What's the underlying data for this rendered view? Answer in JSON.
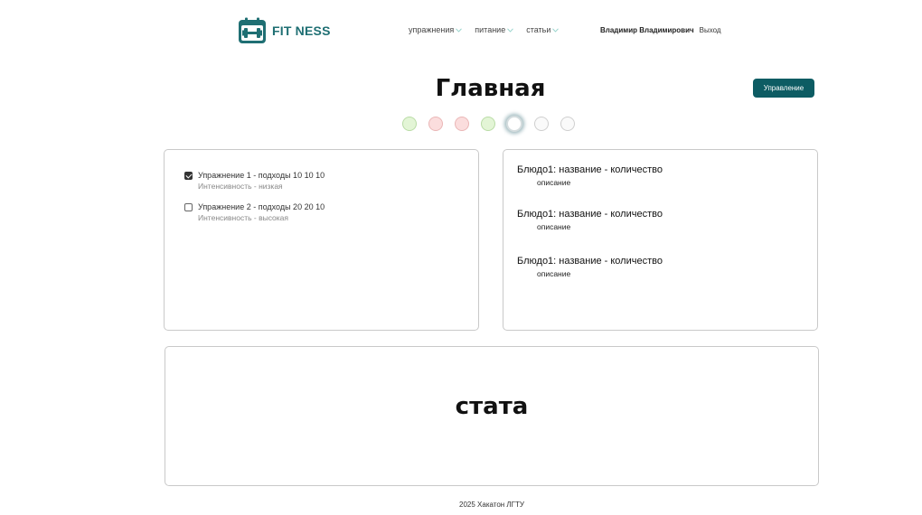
{
  "header": {
    "logo_text": "FIT NESS",
    "nav": [
      {
        "label": "упражнения"
      },
      {
        "label": "питание"
      },
      {
        "label": "статьи"
      }
    ],
    "user_name": "Владимир Владимирович",
    "logout_label": "Выход"
  },
  "main": {
    "title": "Главная",
    "manage_button": "Управление",
    "day_indicators": [
      "green",
      "red",
      "red",
      "green",
      "active",
      "neutral",
      "neutral"
    ]
  },
  "exercises": [
    {
      "title": "Упражнение 1 - подходы 10 10 10",
      "subtitle": "Интенсивность - низкая",
      "checked": true
    },
    {
      "title": "Упражнение 2 - подходы 20 20 10",
      "subtitle": "Интенсивность - высокая",
      "checked": false
    }
  ],
  "meals": [
    {
      "title": "Блюдо1: название - количество",
      "description": "описание"
    },
    {
      "title": "Блюдо1: название - количество",
      "description": "описание"
    },
    {
      "title": "Блюдо1: название - количество",
      "description": "описание"
    }
  ],
  "stats": {
    "label": "стата"
  },
  "footer": {
    "text": "2025 Хакатон ЛГТУ"
  },
  "colors": {
    "brand": "#1f6f73",
    "button": "#0d5c63",
    "green_day": "#e3f5d6",
    "red_day": "#fbdddd"
  }
}
